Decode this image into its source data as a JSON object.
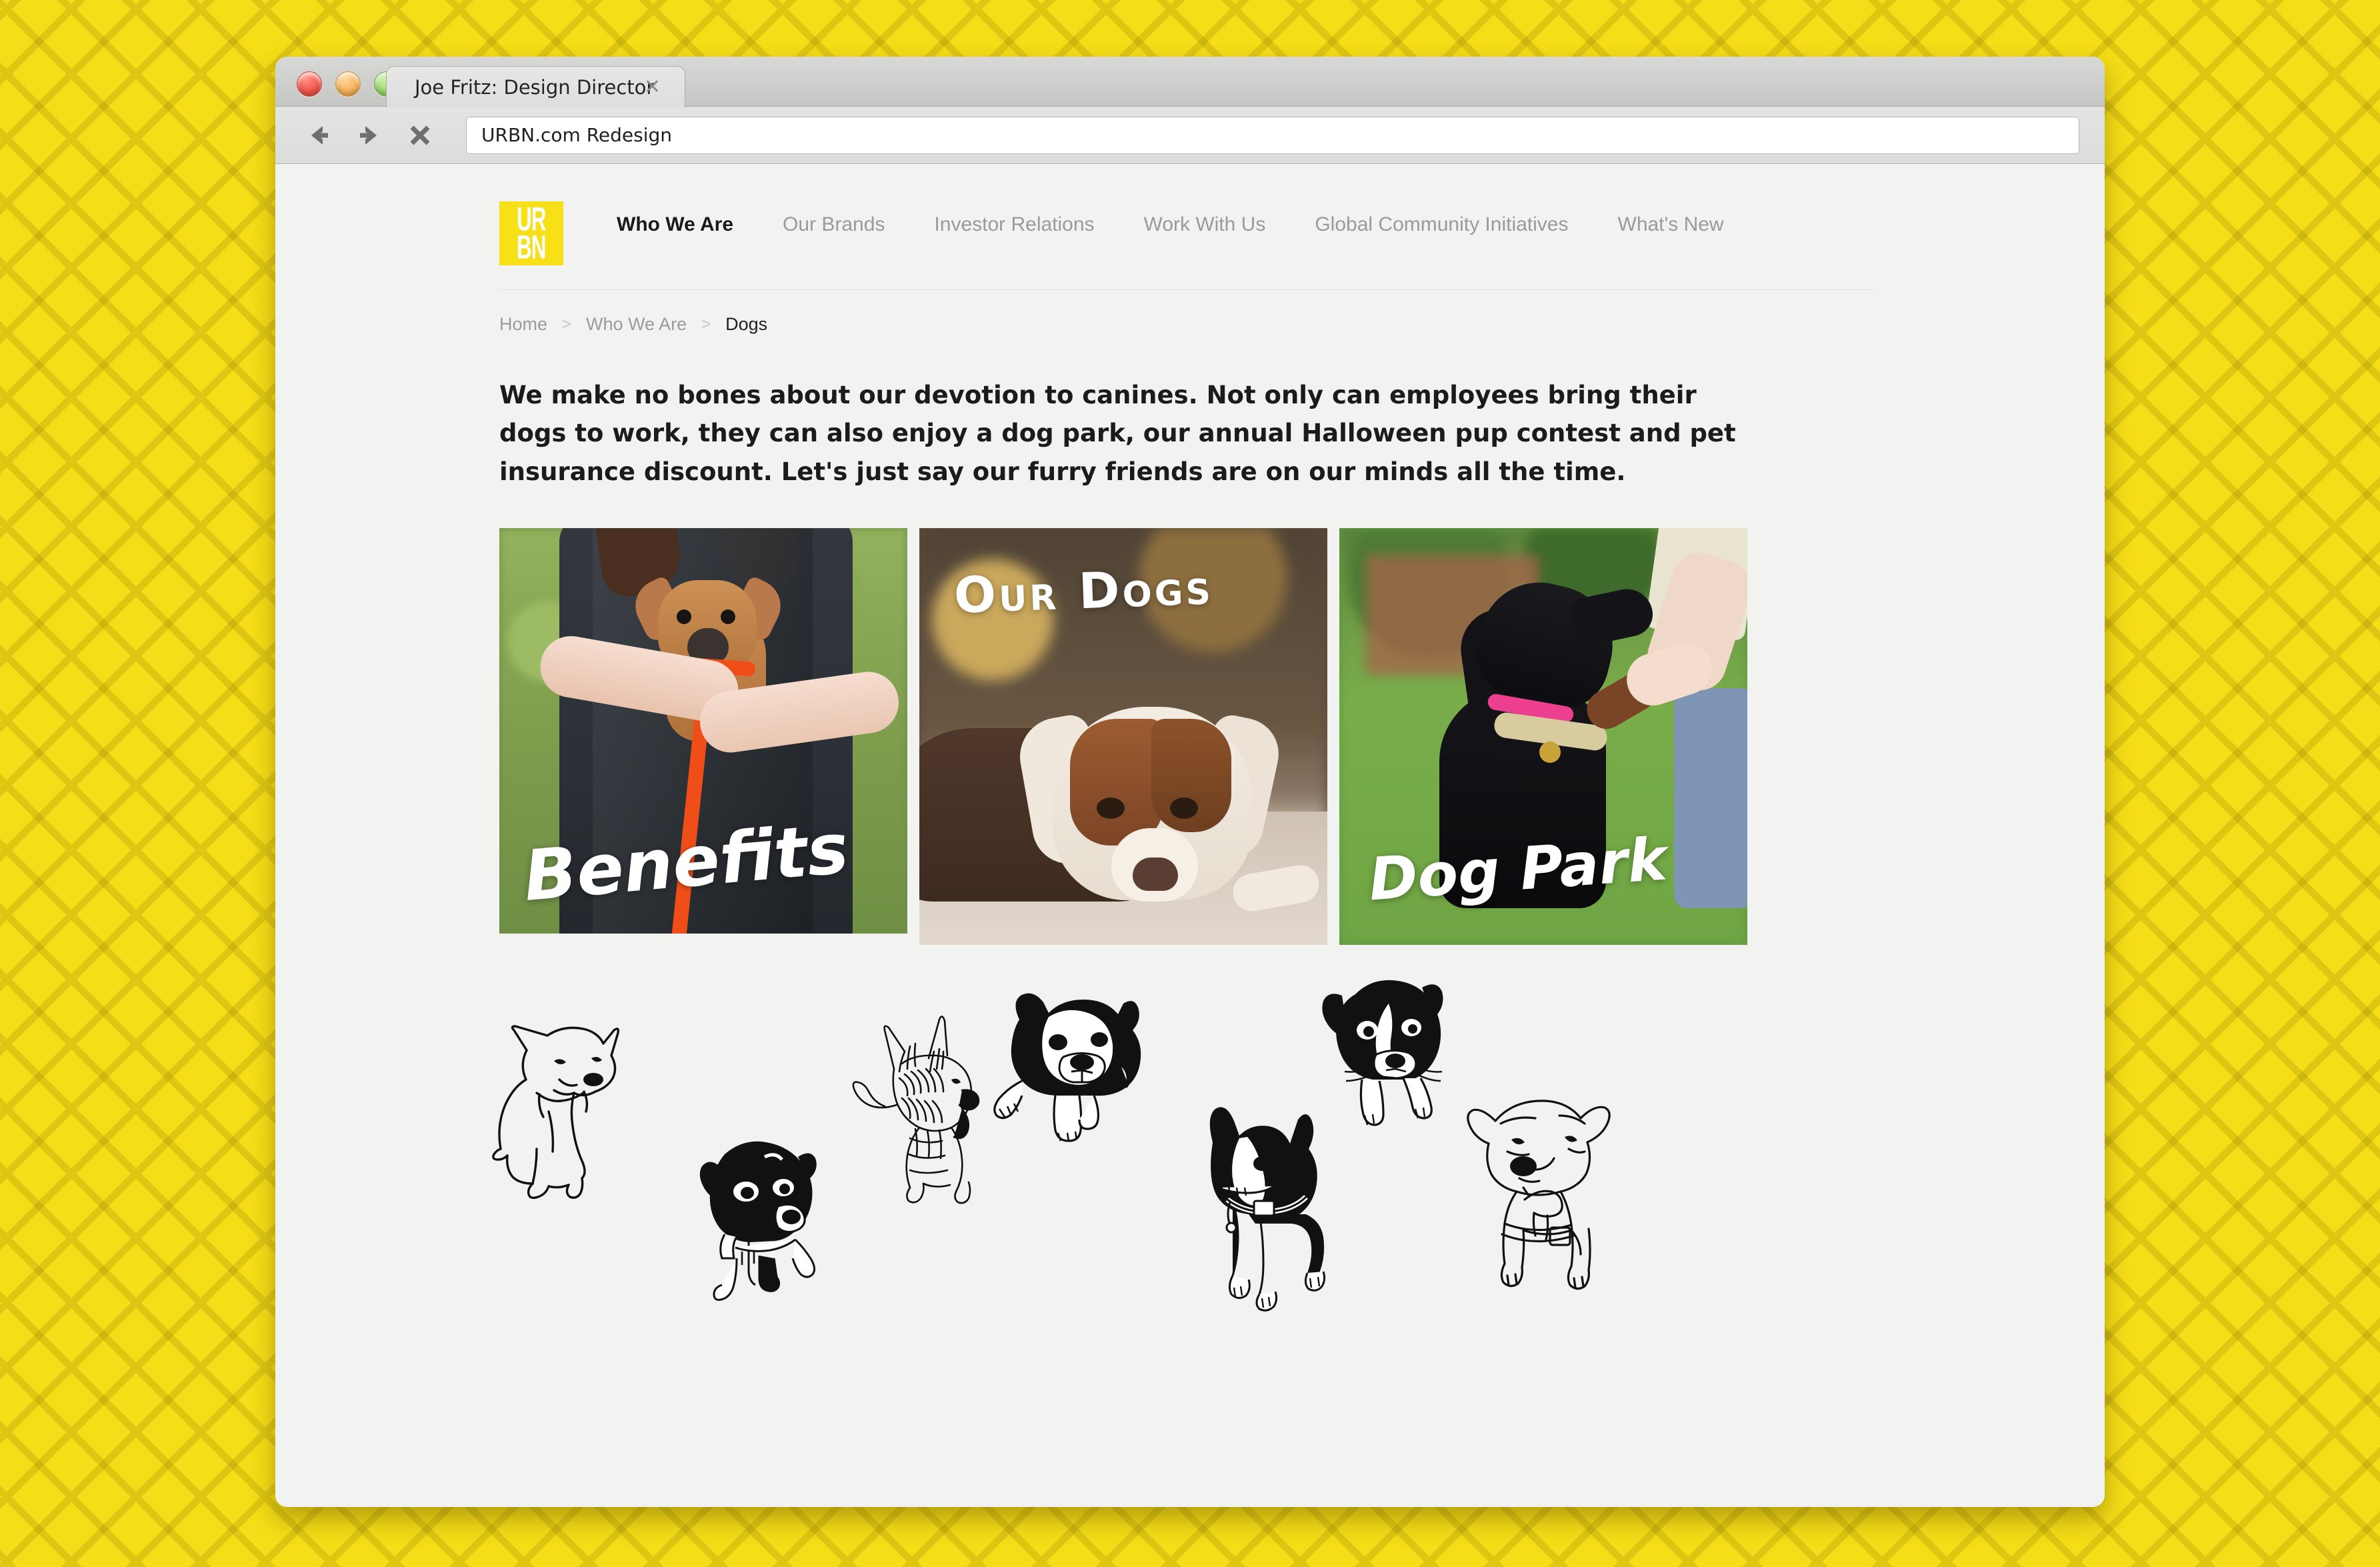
{
  "browser": {
    "tab_title": "Joe Fritz: Design Director",
    "tab_close_icon": "close-icon",
    "traffic_lights": [
      "close",
      "minimize",
      "maximize"
    ],
    "toolbar": {
      "back_icon": "back-arrow-icon",
      "forward_icon": "forward-arrow-icon",
      "stop_icon": "stop-x-icon",
      "url_value": "URBN.com Redesign"
    }
  },
  "site": {
    "logo": {
      "line1": "UR",
      "line2": "BN",
      "background_color": "#f7e018",
      "text_color": "#ffffff"
    },
    "nav": [
      {
        "label": "Who We Are",
        "active": true
      },
      {
        "label": "Our Brands",
        "active": false
      },
      {
        "label": "Investor Relations",
        "active": false
      },
      {
        "label": "Work With Us",
        "active": false
      },
      {
        "label": "Global Community Initiatives",
        "active": false
      },
      {
        "label": "What's New",
        "active": false
      }
    ],
    "breadcrumb": [
      {
        "label": "Home",
        "current": false
      },
      {
        "label": "Who We Are",
        "current": false
      },
      {
        "label": "Dogs",
        "current": true
      }
    ],
    "breadcrumb_separator": ">",
    "intro": "We make no bones about our devotion to canines. Not only can employees bring their dogs to work, they can also enjoy a dog park, our annual Halloween pup contest and pet insurance discount. Let's just say our furry friends are on our minds all the time.",
    "cards": [
      {
        "label": "Benefits",
        "alt": "person in denim jacket holding a tan chihuahua puppy on an orange leash"
      },
      {
        "label": "Our Dogs",
        "alt": "brown and white puppy lying on a wooden floor"
      },
      {
        "label": "Dog Park",
        "alt": "black dog shaking paws with a person on green grass"
      }
    ],
    "illustrations": [
      {
        "name": "jack-russell-sitting-illustration"
      },
      {
        "name": "black-puppy-lying-illustration"
      },
      {
        "name": "scruffy-terrier-illustration"
      },
      {
        "name": "boston-bulldog-puppy-illustration"
      },
      {
        "name": "boston-terrier-standing-illustration"
      },
      {
        "name": "black-white-puppy-looking-up-illustration"
      },
      {
        "name": "staffordshire-terrier-illustration"
      }
    ]
  },
  "theme": {
    "background_yellow": "#f5dd17",
    "page_background": "#f2f2f0",
    "accent_yellow": "#f7e018",
    "text_dark": "#1b1b1b",
    "text_muted": "#9a9a9a"
  }
}
